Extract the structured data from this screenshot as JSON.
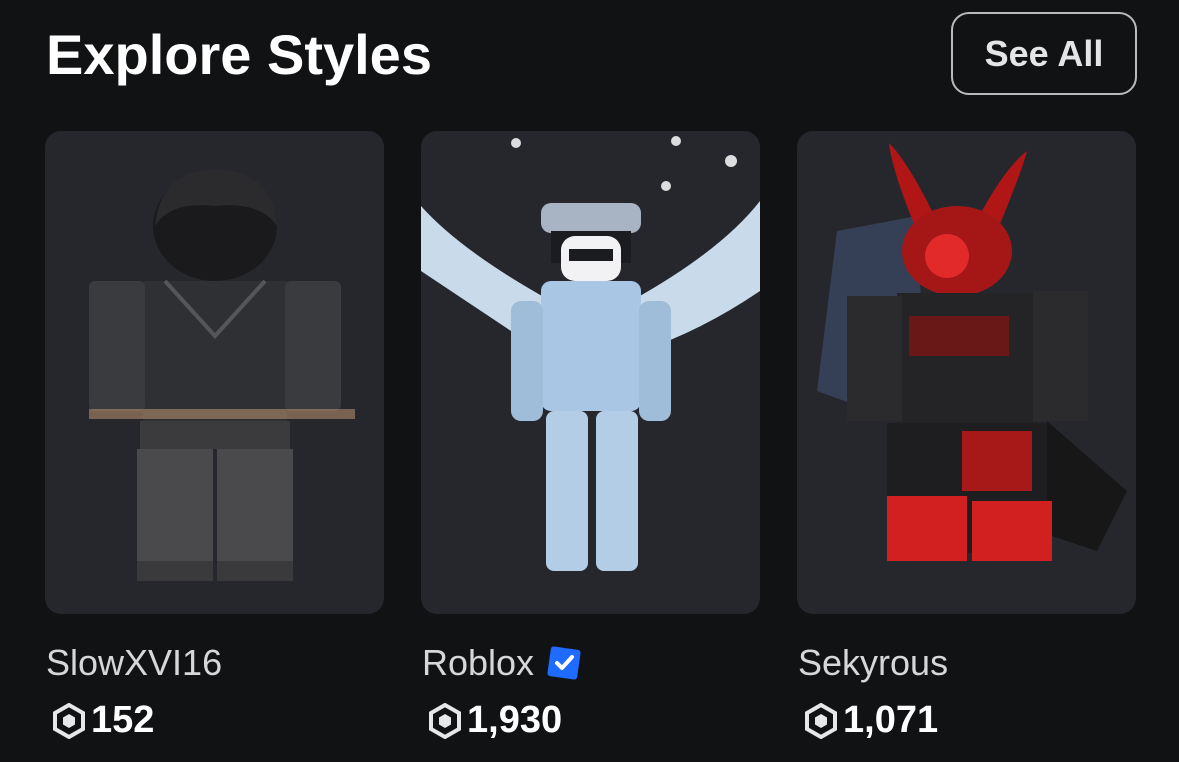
{
  "section": {
    "title": "Explore Styles",
    "see_all_label": "See All"
  },
  "styles": [
    {
      "creator": "SlowXVI16",
      "price": "152",
      "verified": false,
      "avatar_icon": "dark-outfit-avatar"
    },
    {
      "creator": "Roblox",
      "price": "1,930",
      "verified": true,
      "avatar_icon": "crystal-angel-avatar"
    },
    {
      "creator": "Sekyrous",
      "price": "1,071",
      "verified": false,
      "avatar_icon": "red-demon-avatar"
    }
  ],
  "colors": {
    "background": "#111214",
    "card": "#26272d",
    "verified_badge": "#1f6bff"
  },
  "icons": {
    "currency": "robux-icon",
    "verified": "verified-badge-icon"
  }
}
